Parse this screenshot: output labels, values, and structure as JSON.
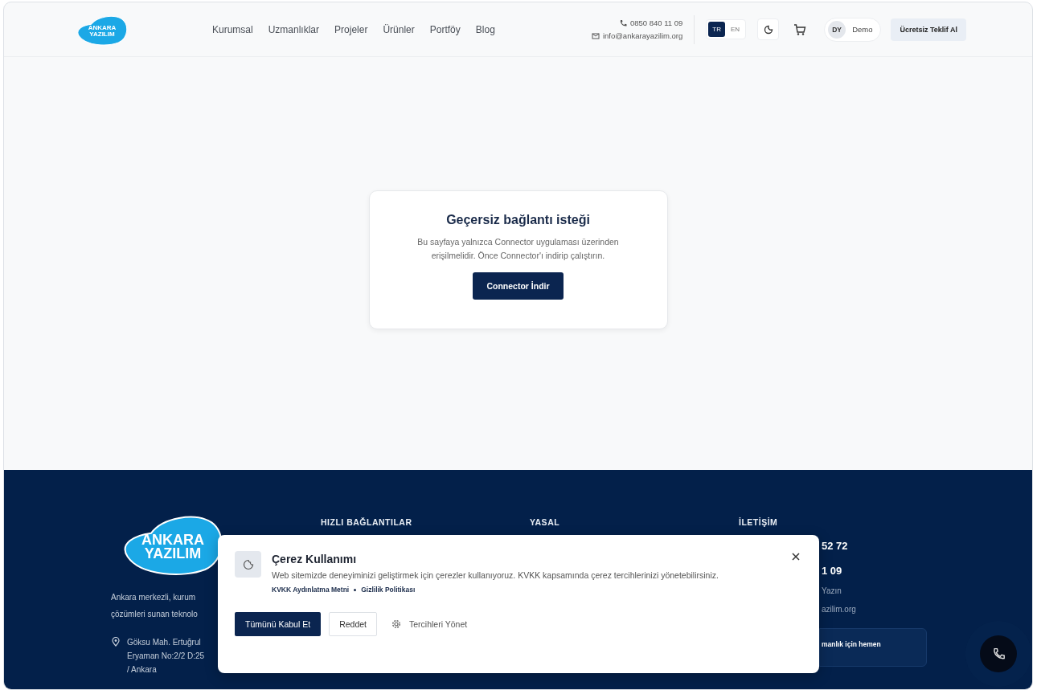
{
  "header": {
    "logo": {
      "line1": "ANKARA",
      "line2": "YAZILIM"
    },
    "nav": [
      "Kurumsal",
      "Uzmanlıklar",
      "Projeler",
      "Ürünler",
      "Portföy",
      "Blog"
    ],
    "phone": "0850 840 11 09",
    "email": "info@ankarayazilim.org",
    "languages": [
      {
        "label": "TR",
        "selected": true
      },
      {
        "label": "EN",
        "selected": false
      }
    ],
    "user": {
      "initials": "DY",
      "name": "Demo"
    },
    "cta": "Ücretsiz Teklif Al"
  },
  "error_card": {
    "title": "Geçersiz bağlantı isteği",
    "message": "Bu sayfaya yalnızca Connector uygulaması üzerinden erişilmelidir. Önce Connector'ı indirip çalıştırın.",
    "button": "Connector İndir"
  },
  "footer": {
    "logo": {
      "line1": "ANKARA",
      "line2": "YAZILIM"
    },
    "about": [
      "Ankara merkezli, kurum",
      "çözümleri sunan teknolo"
    ],
    "address": [
      "Göksu Mah. Ertuğrul",
      "Eryaman No:2/2 D:25",
      "/ Ankara"
    ],
    "headings": [
      "HIZLI BAĞLANTILAR",
      "YASAL",
      "İLETİŞİM"
    ],
    "contact": [
      {
        "kind": "strong",
        "text": "52 72"
      },
      {
        "kind": "strong",
        "text": "1 09"
      },
      {
        "kind": "plain",
        "text": "Yazın"
      },
      {
        "kind": "plain",
        "text": "azilim.org"
      },
      {
        "kind": "box",
        "text": "manlık için hemen"
      }
    ]
  },
  "cookie_banner": {
    "title": "Çerez Kullanımı",
    "message": "Web sitemizde deneyiminizi geliştirmek için çerezler kullanıyoruz. KVKK kapsamında çerez tercihlerinizi yönetebilirsiniz.",
    "links": [
      "KVKK Aydınlatma Metni",
      "Gizlilik Politikası"
    ],
    "accept": "Tümünü Kabul Et",
    "reject": "Reddet",
    "manage": "Tercihleri Yönet"
  }
}
